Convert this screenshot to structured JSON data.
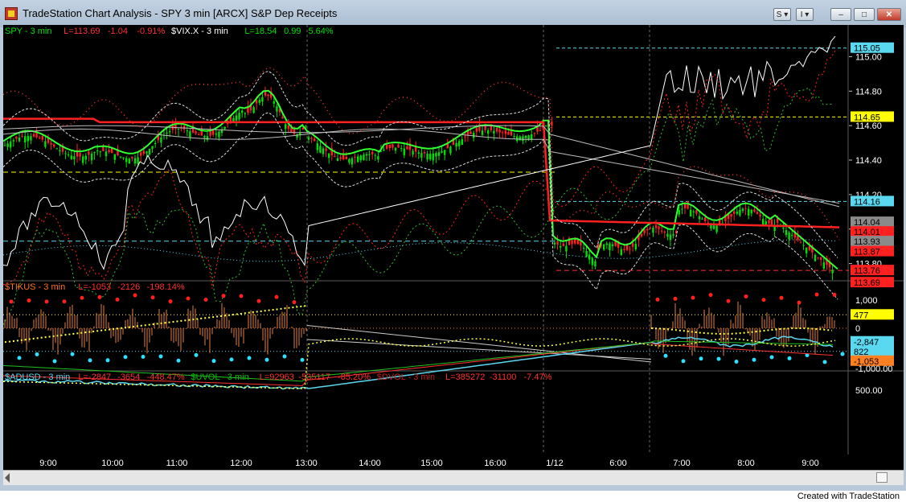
{
  "window": {
    "title": "TradeStation Chart Analysis - SPY 3 min [ARCX] S&P Dep Receipts",
    "btn_s": "S ▾",
    "btn_i": "I ▾",
    "footer": "Created with TradeStation"
  },
  "panels": {
    "price": {
      "legend": [
        {
          "text": "SPY - 3 min",
          "color": "#00e000"
        },
        {
          "text": "L=113.69",
          "color": "#ff3030"
        },
        {
          "text": "-1.04",
          "color": "#ff3030"
        },
        {
          "text": "-0.91%",
          "color": "#ff3030"
        },
        {
          "text": "$VIX.X - 3 min",
          "color": "#ffffff"
        },
        {
          "text": "L=18.54",
          "color": "#00e000"
        },
        {
          "text": "0.99",
          "color": "#00e000"
        },
        {
          "text": "5.64%",
          "color": "#00e000"
        }
      ],
      "ticks": [
        "115.00",
        "114.80",
        "114.60",
        "114.40",
        "114.20",
        "114.00",
        "113.80"
      ],
      "badges": [
        {
          "text": "115.05",
          "bg": "#5ad8f0",
          "fg": "#000000",
          "v": 115.05
        },
        {
          "text": "114.65",
          "bg": "#ffff00",
          "fg": "#000000",
          "v": 114.65
        },
        {
          "text": "114.16",
          "bg": "#5ad8f0",
          "fg": "#000000",
          "v": 114.16
        },
        {
          "text": "114.04",
          "bg": "#8a8a8a",
          "fg": "#000000",
          "v": 114.04
        },
        {
          "text": "114.01",
          "bg": "#ff2020",
          "fg": "#000000",
          "v": 114.01
        },
        {
          "text": "113.93",
          "bg": "#8a8a8a",
          "fg": "#000000",
          "v": 113.93
        },
        {
          "text": "113.87",
          "bg": "#ff2020",
          "fg": "#000000",
          "v": 113.87
        },
        {
          "text": "113.76",
          "bg": "#ff2020",
          "fg": "#000000",
          "v": 113.76
        },
        {
          "text": "113.69",
          "bg": "#ff2020",
          "fg": "#000000",
          "v": 113.69
        }
      ]
    },
    "tikus": {
      "legend": [
        {
          "text": "$TIKUS - 3 min",
          "color": "#ff7020"
        },
        {
          "text": "L=-1053",
          "color": "#ff3030"
        },
        {
          "text": "-2126",
          "color": "#ff3030"
        },
        {
          "text": "-198.14%",
          "color": "#ff3030"
        }
      ],
      "ticks": [
        "1,000",
        "0"
      ],
      "badges": [
        {
          "text": "477",
          "bg": "#ffff00",
          "fg": "#000000",
          "v": 477
        },
        {
          "text": "822",
          "bg": "#5ad8f0",
          "fg": "#000000",
          "v": -822
        },
        {
          "text": "-1,053",
          "bg": "#ff8020",
          "fg": "#000000",
          "v": -1053
        }
      ]
    },
    "adusd": {
      "legend": [
        {
          "text": "$ADUSD - 3 min",
          "color": "#5ad8f0"
        },
        {
          "text": "L=-2847",
          "color": "#ff3030"
        },
        {
          "text": "-3654",
          "color": "#ff3030"
        },
        {
          "text": "-448.47%",
          "color": "#ff3030"
        },
        {
          "text": "$UVOL - 3 min",
          "color": "#00c000"
        },
        {
          "text": "L=92963",
          "color": "#ff3030"
        },
        {
          "text": "-535117",
          "color": "#ff3030"
        },
        {
          "text": "-85.20%",
          "color": "#ff3030"
        },
        {
          "text": "$DVOL - 3 min",
          "color": "#c02020"
        },
        {
          "text": "L=385272",
          "color": "#ff3030"
        },
        {
          "text": "-31100",
          "color": "#ff3030"
        },
        {
          "text": "-7.47%",
          "color": "#ff3030"
        }
      ],
      "ticks": [
        "500.00",
        "-1,000.00"
      ],
      "badges": [
        {
          "text": "-2,847",
          "bg": "#5ad8f0",
          "fg": "#000000",
          "v": -2847
        }
      ]
    }
  },
  "time_axis": [
    "9:00",
    "10:00",
    "11:00",
    "12:00",
    "13:00",
    "14:00",
    "15:00",
    "16:00",
    "1/12",
    "6:00",
    "7:00",
    "8:00",
    "9:00"
  ]
}
